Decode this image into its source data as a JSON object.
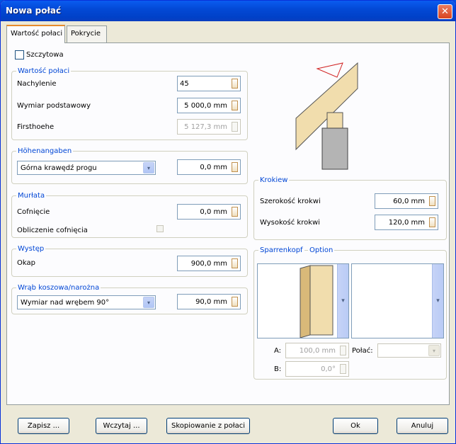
{
  "window": {
    "title": "Nowa połać",
    "close_glyph": "✕"
  },
  "tabs": [
    {
      "label": "Wartość połaci",
      "active": true
    },
    {
      "label": "Pokrycie",
      "active": false
    }
  ],
  "gable": {
    "label": "Szczytowa",
    "checked": false
  },
  "roof_value": {
    "title": "Wartość połaci",
    "pitch_label": "Nachylenie",
    "pitch_value": "45",
    "base_label": "Wymiar podstawowy",
    "base_value": "5 000,0 mm",
    "ridge_label": "Firsthoehe",
    "ridge_value": "5 127,3 mm"
  },
  "height": {
    "title": "Höhenangaben",
    "reference_selected": "Górna krawędź progu",
    "value": "0,0 mm"
  },
  "wallplate": {
    "title": "Murłata",
    "offset_label": "Cofnięcie",
    "offset_value": "0,0 mm",
    "calc_label": "Obliczenie cofnięcia",
    "calc_checked": false
  },
  "overhang": {
    "title": "Występ",
    "eave_label": "Okap",
    "eave_value": "900,0 mm"
  },
  "notch": {
    "title": "Wrąb koszowa/narożna",
    "type_selected": "Wymiar nad wrębem 90°",
    "value": "90,0 mm"
  },
  "rafter": {
    "title": "Krokiew",
    "width_label": "Szerokość krokwi",
    "width_value": "60,0 mm",
    "height_label": "Wysokość krokwi",
    "height_value": "120,0 mm"
  },
  "rafter_head": {
    "title": "Sparrenkopf",
    "option_label": "Option",
    "a_label": "A:",
    "a_value": "100,0 mm",
    "b_label": "B:",
    "b_value": "0,0°",
    "roof_label": "Połać:",
    "roof_selected": ""
  },
  "buttons": {
    "save": "Zapisz ...",
    "load": "Wczytaj ...",
    "copy": "Skopiowanie z połaci",
    "ok": "Ok",
    "cancel": "Anuluj"
  },
  "icons": {
    "dropdown": "▾",
    "scroll_down": "▾"
  },
  "colors": {
    "title_bar": "#0054e3",
    "group_title": "#0046d5",
    "wood": "#f1ddad",
    "concrete": "#b4b4b4"
  }
}
